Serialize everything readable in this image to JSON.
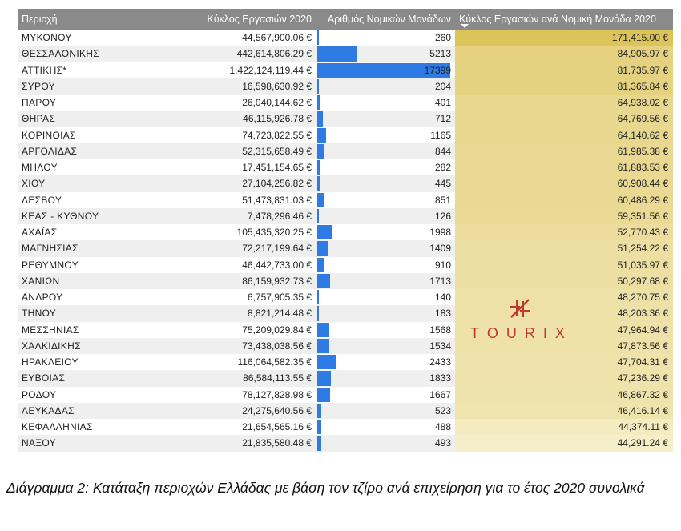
{
  "headers": [
    "Περιοχή",
    "Κύκλος Εργασιών 2020",
    "Αριθμός Νομικών Μονάδων",
    "Κύκλος Εργασιών ανά Νομική Μονάδα 2020"
  ],
  "caption": "Διάγραμμα 2: Κατάταξη περιοχών Ελλάδας με βάση τον τζίρο ανά επιχείρηση για το έτος 2020 συνολικά",
  "logo_text": "TOURIX",
  "sort_icon": "sort-descending-icon",
  "colors": {
    "header_bg": "#8a8a8a",
    "bar": "#2f7be6",
    "heat_high": "#dcc35a",
    "heat_low": "#f6eec9",
    "logo": "#c0392b"
  },
  "chart_data": {
    "type": "table",
    "columns": [
      "Περιοχή",
      "Κύκλος Εργασιών 2020",
      "Αριθμός Νομικών Μονάδων",
      "Κύκλος Εργασιών ανά Νομική Μονάδα 2020"
    ],
    "sort": {
      "column": "Κύκλος Εργασιών ανά Νομική Μονάδα 2020",
      "order": "descending"
    },
    "bar_max": 17399,
    "rows": [
      {
        "region": "ΜΥΚΟΝΟΥ",
        "turnover": "44,567,900.06 €",
        "units": 260,
        "per_unit": "171,415.00 €",
        "per_unit_value": 171415.0
      },
      {
        "region": "ΘΕΣΣΑΛΟΝΙΚΗΣ",
        "turnover": "442,614,806.29 €",
        "units": 5213,
        "per_unit": "84,905.97 €",
        "per_unit_value": 84905.97
      },
      {
        "region": "ΑΤΤΙΚΗΣ*",
        "turnover": "1,422,124,119.44 €",
        "units": 17399,
        "per_unit": "81,735.97 €",
        "per_unit_value": 81735.97
      },
      {
        "region": "ΣΥΡΟΥ",
        "turnover": "16,598,630.92 €",
        "units": 204,
        "per_unit": "81,365.84 €",
        "per_unit_value": 81365.84
      },
      {
        "region": "ΠΑΡΟΥ",
        "turnover": "26,040,144.62 €",
        "units": 401,
        "per_unit": "64,938.02 €",
        "per_unit_value": 64938.02
      },
      {
        "region": "ΘΗΡΑΣ",
        "turnover": "46,115,926.78 €",
        "units": 712,
        "per_unit": "64,769.56 €",
        "per_unit_value": 64769.56
      },
      {
        "region": "ΚΟΡΙΝΘΙΑΣ",
        "turnover": "74,723,822.55 €",
        "units": 1165,
        "per_unit": "64,140.62 €",
        "per_unit_value": 64140.62
      },
      {
        "region": "ΑΡΓΟΛΙΔΑΣ",
        "turnover": "52,315,658.49 €",
        "units": 844,
        "per_unit": "61,985.38 €",
        "per_unit_value": 61985.38
      },
      {
        "region": "ΜΗΛΟΥ",
        "turnover": "17,451,154.65 €",
        "units": 282,
        "per_unit": "61,883.53 €",
        "per_unit_value": 61883.53
      },
      {
        "region": "ΧΙΟΥ",
        "turnover": "27,104,256.82 €",
        "units": 445,
        "per_unit": "60,908.44 €",
        "per_unit_value": 60908.44
      },
      {
        "region": "ΛΕΣΒΟΥ",
        "turnover": "51,473,831.03 €",
        "units": 851,
        "per_unit": "60,486.29 €",
        "per_unit_value": 60486.29
      },
      {
        "region": "ΚΕΑΣ - ΚΥΘΝΟΥ",
        "turnover": "7,478,296.46 €",
        "units": 126,
        "per_unit": "59,351.56 €",
        "per_unit_value": 59351.56
      },
      {
        "region": "ΑΧΑΪΑΣ",
        "turnover": "105,435,320.25 €",
        "units": 1998,
        "per_unit": "52,770.43 €",
        "per_unit_value": 52770.43
      },
      {
        "region": "ΜΑΓΝΗΣΙΑΣ",
        "turnover": "72,217,199.64 €",
        "units": 1409,
        "per_unit": "51,254.22 €",
        "per_unit_value": 51254.22
      },
      {
        "region": "ΡΕΘΥΜΝΟΥ",
        "turnover": "46,442,733.00 €",
        "units": 910,
        "per_unit": "51,035.97 €",
        "per_unit_value": 51035.97
      },
      {
        "region": "ΧΑΝΙΩΝ",
        "turnover": "86,159,932.73 €",
        "units": 1713,
        "per_unit": "50,297.68 €",
        "per_unit_value": 50297.68
      },
      {
        "region": "ΑΝΔΡΟΥ",
        "turnover": "6,757,905.35 €",
        "units": 140,
        "per_unit": "48,270.75 €",
        "per_unit_value": 48270.75
      },
      {
        "region": "ΤΗΝΟΥ",
        "turnover": "8,821,214.48 €",
        "units": 183,
        "per_unit": "48,203.36 €",
        "per_unit_value": 48203.36
      },
      {
        "region": "ΜΕΣΣΗΝΙΑΣ",
        "turnover": "75,209,029.84 €",
        "units": 1568,
        "per_unit": "47,964.94 €",
        "per_unit_value": 47964.94
      },
      {
        "region": "ΧΑΛΚΙΔΙΚΗΣ",
        "turnover": "73,438,038.56 €",
        "units": 1534,
        "per_unit": "47,873.56 €",
        "per_unit_value": 47873.56
      },
      {
        "region": "ΗΡΑΚΛΕΙΟΥ",
        "turnover": "116,064,582.35 €",
        "units": 2433,
        "per_unit": "47,704.31 €",
        "per_unit_value": 47704.31
      },
      {
        "region": "ΕΥΒΟΙΑΣ",
        "turnover": "86,584,113.55 €",
        "units": 1833,
        "per_unit": "47,236.29 €",
        "per_unit_value": 47236.29
      },
      {
        "region": "ΡΟΔΟΥ",
        "turnover": "78,127,828.98 €",
        "units": 1667,
        "per_unit": "46,867.32 €",
        "per_unit_value": 46867.32
      },
      {
        "region": "ΛΕΥΚΑΔΑΣ",
        "turnover": "24,275,640.56 €",
        "units": 523,
        "per_unit": "46,416.14 €",
        "per_unit_value": 46416.14
      },
      {
        "region": "ΚΕΦΑΛΛΗΝΙΑΣ",
        "turnover": "21,654,565.16 €",
        "units": 488,
        "per_unit": "44,374.11 €",
        "per_unit_value": 44374.11
      },
      {
        "region": "ΝΑΞΟΥ",
        "turnover": "21,835,580.48 €",
        "units": 493,
        "per_unit": "44,291.24 €",
        "per_unit_value": 44291.24
      }
    ]
  }
}
